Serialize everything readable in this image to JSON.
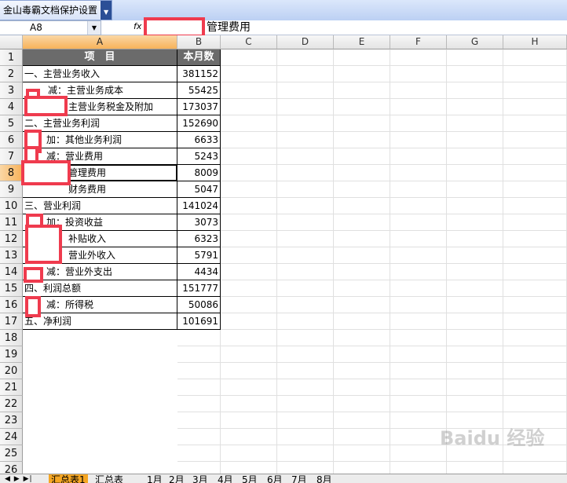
{
  "toolbar": {
    "plugin_label": "金山毒霸文档保护设置"
  },
  "formula_bar": {
    "cell_ref": "A8",
    "fx": "fx",
    "content": "管理费用"
  },
  "columns": [
    "A",
    "B",
    "C",
    "D",
    "E",
    "F",
    "G",
    "H"
  ],
  "rows": [
    "1",
    "2",
    "3",
    "4",
    "5",
    "6",
    "7",
    "8",
    "9",
    "10",
    "11",
    "12",
    "13",
    "14",
    "15",
    "16",
    "17",
    "18",
    "19",
    "20",
    "21",
    "22",
    "23",
    "24",
    "25",
    "26"
  ],
  "table": {
    "header": {
      "item": "项　目",
      "month": "本月数"
    },
    "rows": [
      {
        "label": "一、主营业务收入",
        "value": "381152"
      },
      {
        "label": "减：主营业务成本",
        "value": "55425"
      },
      {
        "label": "主营业务税金及附加",
        "value": "173037"
      },
      {
        "label": "二、主营业务利润",
        "value": "152690"
      },
      {
        "label": "加：其他业务利润",
        "value": "6633"
      },
      {
        "label": "减：营业费用",
        "value": "5243"
      },
      {
        "label": "管理费用",
        "value": "8009"
      },
      {
        "label": "财务费用",
        "value": "5047"
      },
      {
        "label": "三、营业利润",
        "value": "141024"
      },
      {
        "label": "加：投资收益",
        "value": "3073"
      },
      {
        "label": "补贴收入",
        "value": "6323"
      },
      {
        "label": "营业外收入",
        "value": "5791"
      },
      {
        "label": "减：营业外支出",
        "value": "4434"
      },
      {
        "label": "四、利润总额",
        "value": "151777"
      },
      {
        "label": "减：所得税",
        "value": "50086"
      },
      {
        "label": "五、净利润",
        "value": "101691"
      }
    ]
  },
  "sheet_tabs": {
    "nav": "◀ ▶ ▶|",
    "tabs": [
      "汇总表1",
      "汇总表",
      "1月",
      "2月",
      "3月",
      "4月",
      "5月",
      "6月",
      "7月",
      "8月"
    ]
  },
  "watermark": "Baidu 经验"
}
